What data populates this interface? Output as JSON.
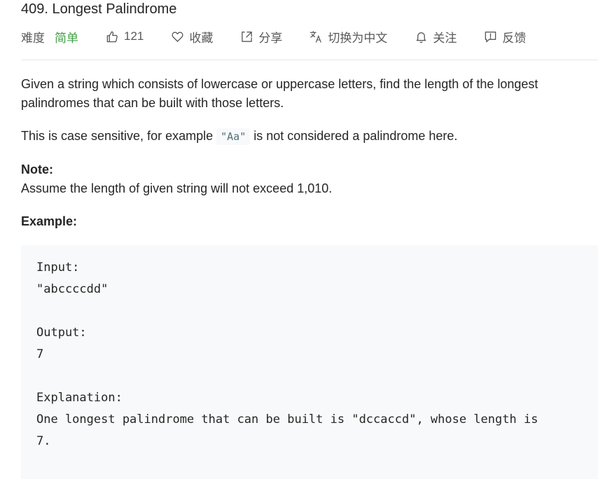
{
  "problem": {
    "title": "409. Longest Palindrome"
  },
  "meta": {
    "difficulty_label": "难度",
    "difficulty_value": "简单",
    "likes": "121",
    "favorite": "收藏",
    "share": "分享",
    "switch_lang": "切换为中文",
    "follow": "关注",
    "feedback": "反馈"
  },
  "description": {
    "p1": "Given a string which consists of lowercase or uppercase letters, find the length of the longest palindromes that can be built with those letters.",
    "p2_before": "This is case sensitive, for example ",
    "p2_code": "\"Aa\"",
    "p2_after": " is not considered a palindrome here.",
    "note_title": "Note:",
    "note_text": "Assume the length of given string will not exceed 1,010.",
    "example_title": "Example:",
    "example_code": "Input:\n\"abccccdd\"\n\nOutput:\n7\n\nExplanation:\nOne longest palindrome that can be built is \"dccaccd\", whose length is\n7."
  },
  "colors": {
    "difficulty_easy": "#43a047",
    "code_bg": "#f7f9fa",
    "divider": "#e6e6e6"
  },
  "icons": [
    "thumbs-up-icon",
    "heart-icon",
    "share-icon",
    "translate-icon",
    "bell-icon",
    "feedback-icon"
  ]
}
